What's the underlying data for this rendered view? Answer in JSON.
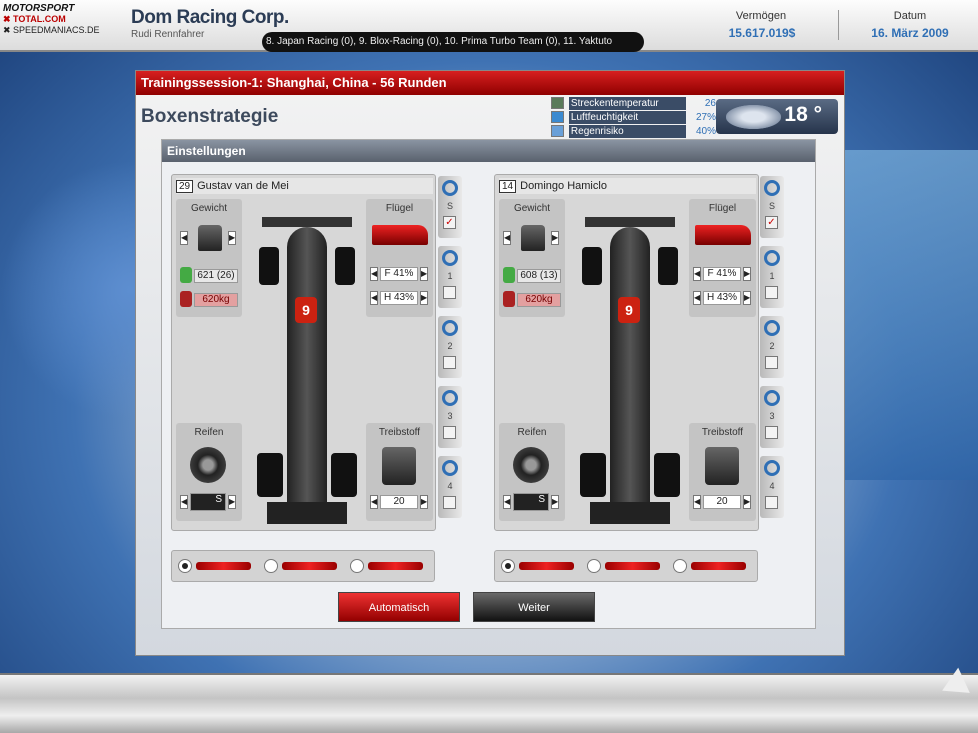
{
  "header": {
    "logo": {
      "line1": "MOTORSPORT",
      "line2": "✖ TOTAL.COM",
      "line3": "✖ SPEEDMANIACS.DE"
    },
    "company": "Dom Racing Corp.",
    "role": "Rudi Rennfahrer",
    "ticker": "8. Japan Racing (0),   9. Blox-Racing (0),   10. Prima Turbo Team (0),   11. Yaktuto",
    "money_label": "Vermögen",
    "money_value": "15.617.019$",
    "date_label": "Datum",
    "date_value": "16. März 2009"
  },
  "window": {
    "title": "Trainingssession-1: Shanghai, China - 56 Runden",
    "heading": "Boxenstrategie",
    "weather": [
      {
        "label": "Streckentemperatur",
        "value": "26",
        "icon": "thermometer-icon"
      },
      {
        "label": "Luftfeuchtigkeit",
        "value": "27%",
        "icon": "humidity-icon"
      },
      {
        "label": "Regenrisiko",
        "value": "40%",
        "icon": "rain-icon"
      }
    ],
    "temperature": "18 °",
    "settings_label": "Einstellungen",
    "drivers": [
      {
        "num": "29",
        "name": "Gustav van de Mei",
        "weight_label": "Gewicht",
        "weight_value": "621 (26)",
        "weight_kg": "620kg",
        "wing_label": "Flügel",
        "wing_front": "F 41%",
        "wing_rear": "H 43%",
        "tyre_label": "Reifen",
        "tyre_value": "S",
        "fuel_label": "Treibstoff",
        "fuel_value": "20",
        "car_number": "9"
      },
      {
        "num": "14",
        "name": "Domingo Hamiclo",
        "weight_label": "Gewicht",
        "weight_value": "608 (13)",
        "weight_kg": "620kg",
        "wing_label": "Flügel",
        "wing_front": "F 41%",
        "wing_rear": "H 43%",
        "tyre_label": "Reifen",
        "tyre_value": "S",
        "fuel_label": "Treibstoff",
        "fuel_value": "20",
        "car_number": "9"
      }
    ],
    "stints": [
      "S",
      "1",
      "2",
      "3",
      "4"
    ],
    "stint_start_checked": "✓",
    "buttons": {
      "auto": "Automatisch",
      "next": "Weiter"
    }
  }
}
